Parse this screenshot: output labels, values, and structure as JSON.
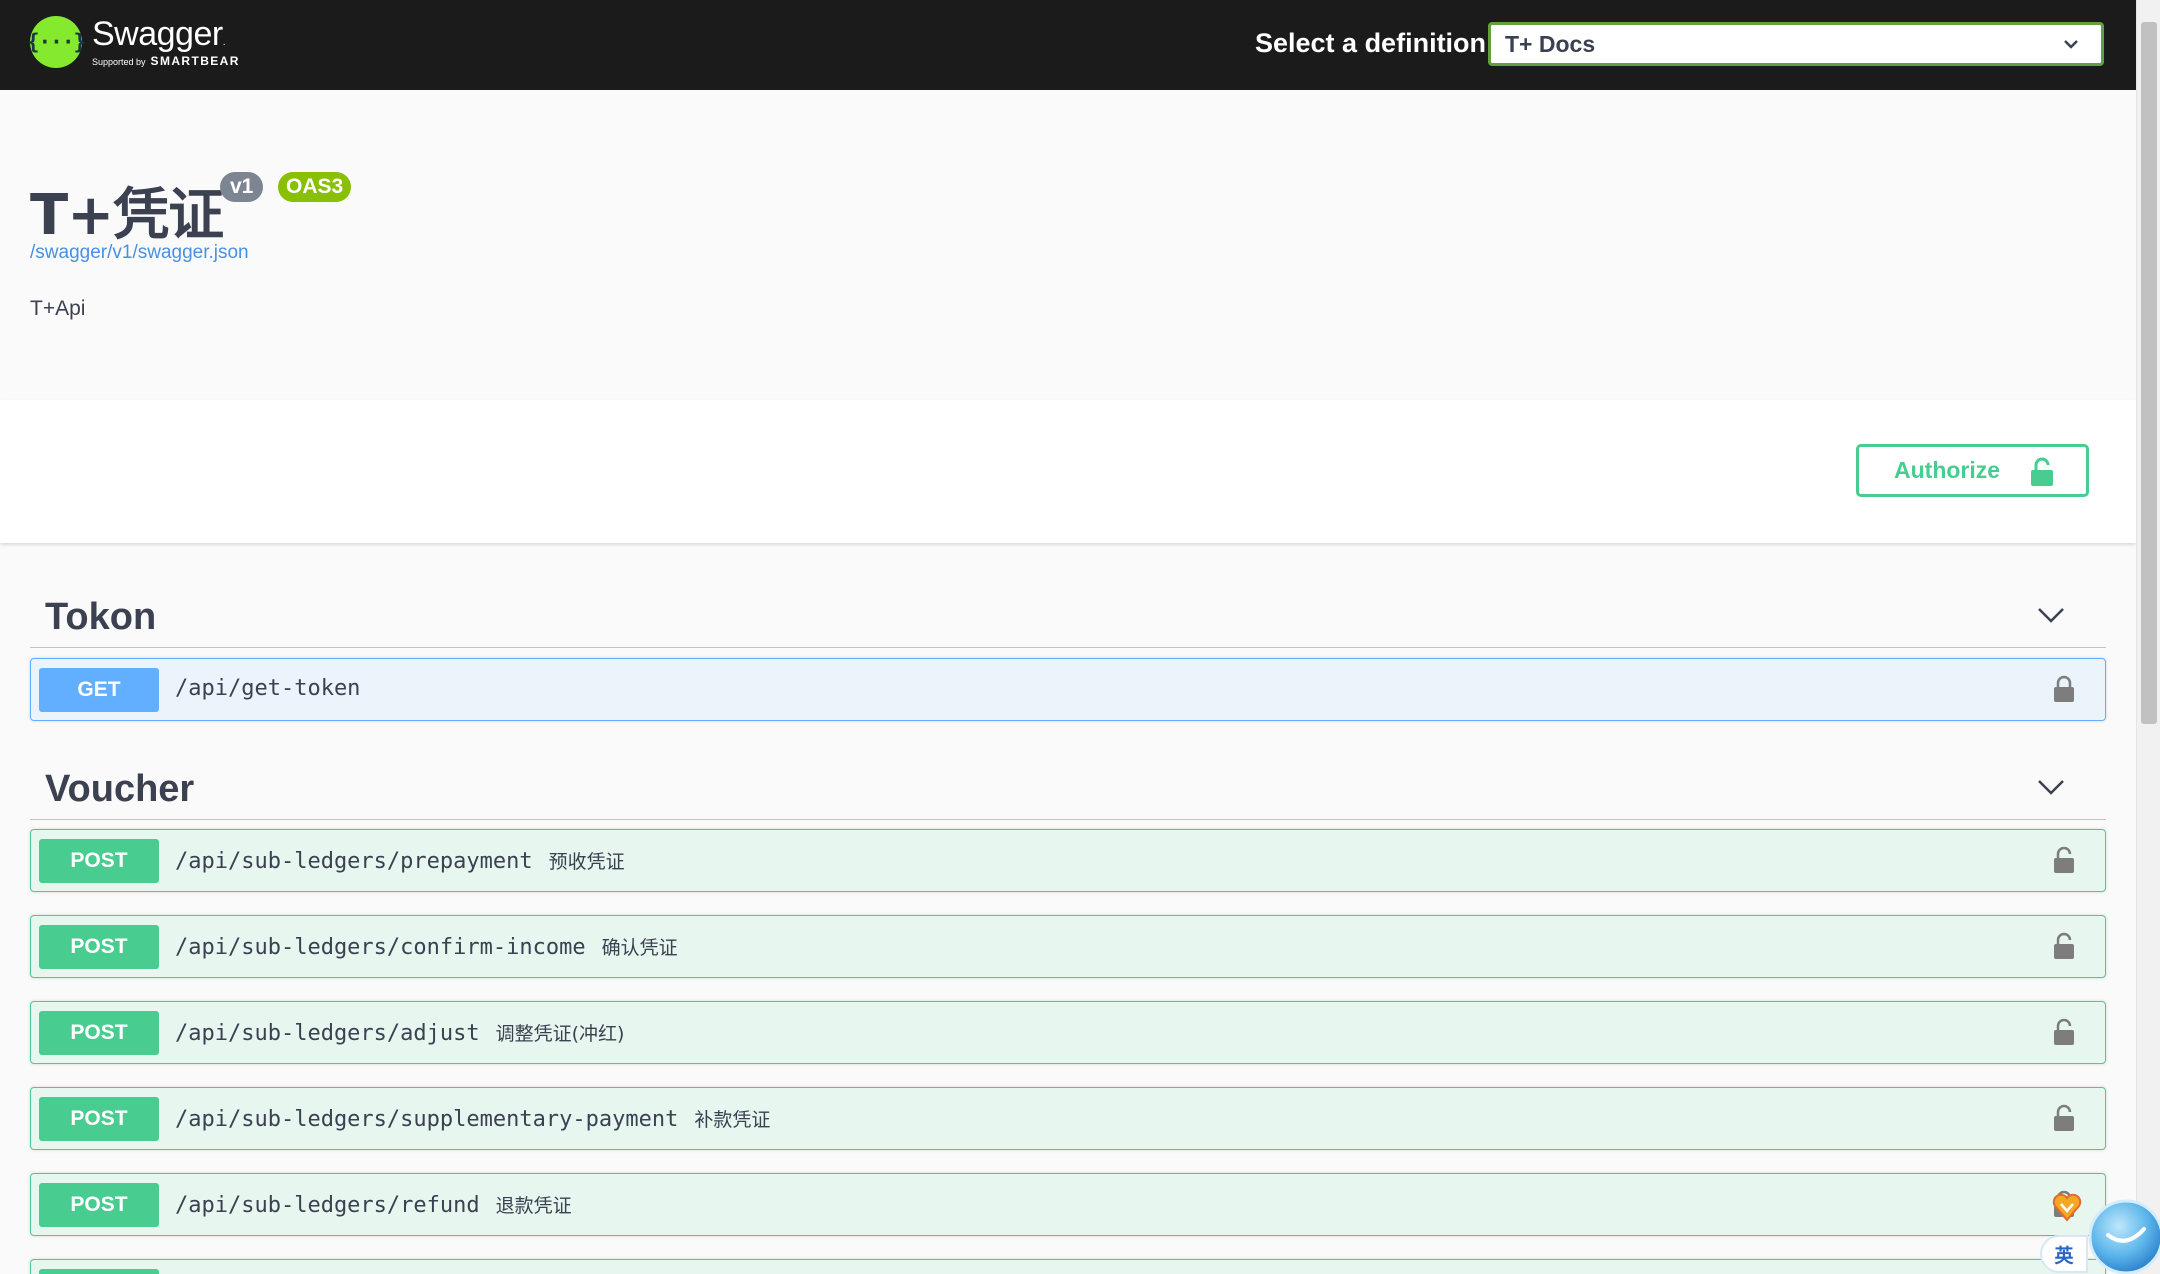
{
  "topbar": {
    "logo_mark": "{···}",
    "logo_name": "Swagger",
    "logo_trademark": ".",
    "logo_supported": "Supported by",
    "logo_brand": "SMARTBEAR",
    "definition_label": "Select a definition",
    "definition_value": "T+ Docs"
  },
  "info": {
    "title": "T+凭证",
    "version": "v1",
    "oas": "OAS3",
    "spec_url": "/swagger/v1/swagger.json",
    "description": "T+Api"
  },
  "scheme": {
    "authorize_label": "Authorize"
  },
  "tags": [
    {
      "name": "Tokon",
      "operations": [
        {
          "method": "GET",
          "path": "/api/get-token",
          "summary": ""
        }
      ]
    },
    {
      "name": "Voucher",
      "operations": [
        {
          "method": "POST",
          "path": "/api/sub-ledgers/prepayment",
          "summary": "预收凭证"
        },
        {
          "method": "POST",
          "path": "/api/sub-ledgers/confirm-income",
          "summary": "确认凭证"
        },
        {
          "method": "POST",
          "path": "/api/sub-ledgers/adjust",
          "summary": "调整凭证(冲红)"
        },
        {
          "method": "POST",
          "path": "/api/sub-ledgers/supplementary-payment",
          "summary": "补款凭证"
        },
        {
          "method": "POST",
          "path": "/api/sub-ledgers/refund",
          "summary": "退款凭证"
        }
      ]
    }
  ],
  "ime": {
    "label": "英"
  },
  "colors": {
    "topbar_bg": "#1b1b1b",
    "get": "#61affe",
    "post": "#49cc90",
    "oas_badge": "#89bf04",
    "version_badge": "#7d8492",
    "link": "#4990e2"
  },
  "icons": [
    "swagger-logo-icon",
    "chevron-down-icon",
    "lock-icon",
    "unlock-icon",
    "ime-icon",
    "assistant-bubble-icon"
  ]
}
